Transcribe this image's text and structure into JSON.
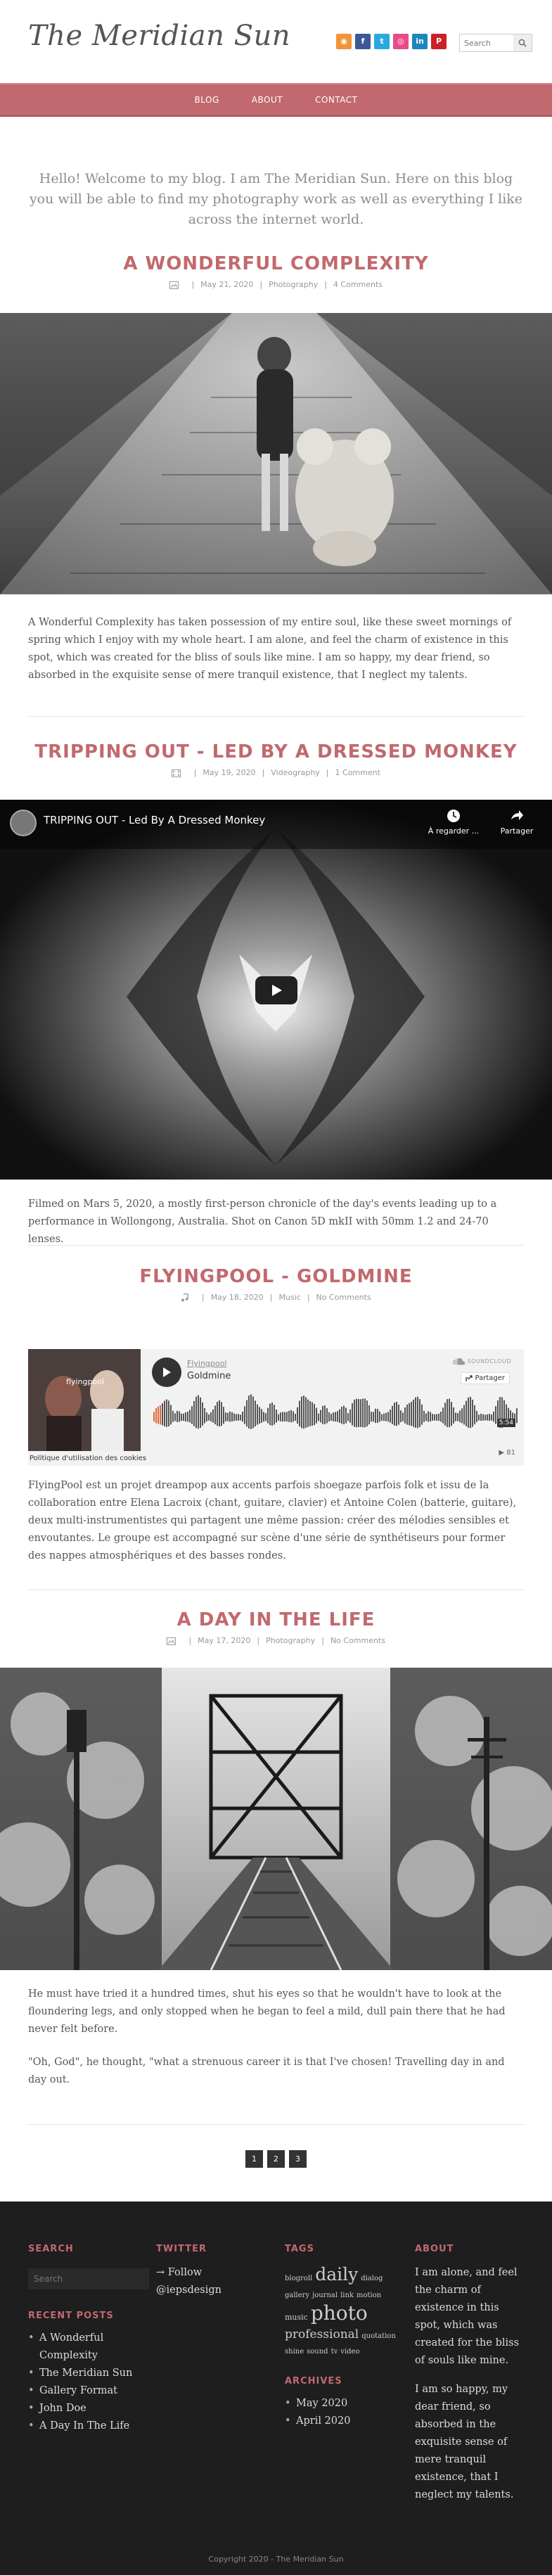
{
  "site": {
    "title": "The Meridian Sun"
  },
  "social_icons": [
    {
      "name": "rss-icon",
      "color": "#f2933a",
      "glyph": "⦿"
    },
    {
      "name": "facebook-icon",
      "color": "#3b5998",
      "glyph": "f"
    },
    {
      "name": "twitter-icon",
      "color": "#2aa9e0",
      "glyph": "t"
    },
    {
      "name": "dribbble-icon",
      "color": "#ea4c89",
      "glyph": "◎"
    },
    {
      "name": "linkedin-icon",
      "color": "#1c87bd",
      "glyph": "in"
    },
    {
      "name": "pinterest-icon",
      "color": "#cb2027",
      "glyph": "P"
    }
  ],
  "search": {
    "placeholder": "Search"
  },
  "nav": {
    "items": [
      "BLOG",
      "ABOUT",
      "CONTACT"
    ]
  },
  "intro": "Hello! Welcome to my blog. I am The Meridian Sun. Here on this blog you will be able to find my photography work as well as everything I like across the internet world.",
  "posts": [
    {
      "title": "A WONDERFUL COMPLEXITY",
      "date": "May 21, 2020",
      "category": "Photography",
      "comments": "4 Comments",
      "excerpt": "A Wonderful Complexity has taken possession of my entire soul, like these sweet mornings of spring which I enjoy with my whole heart. I am alone, and feel the charm of existence in this spot, which was created for the bliss of souls like mine. I am so happy, my dear friend, so absorbed in the exquisite sense of mere tranquil existence, that I neglect my talents."
    },
    {
      "title": "TRIPPING OUT - LED BY A DRESSED MONKEY",
      "date": "May 19, 2020",
      "category": "Videography",
      "comments": "1 Comment",
      "video": {
        "title": "TRIPPING OUT - Led By A Dressed Monkey",
        "watch_later": "À regarder ...",
        "share": "Partager"
      },
      "excerpt": "Filmed on Mars 5, 2020, a mostly first-person chronicle of the day's events leading up to a performance in Wollongong, Australia. Shot on Canon 5D mkII with 50mm 1.2 and 24-70 lenses."
    },
    {
      "title": "FLYINGPOOL - GOLDMINE",
      "date": "May 18, 2020",
      "category": "Music",
      "comments": "No Comments",
      "player": {
        "artist": "Flyingpool",
        "track": "Goldmine",
        "brand": "SOUNDCLOUD",
        "share": "Partager",
        "duration": "5:54",
        "plays": "81",
        "cookie_policy": "Politique d'utilisation des cookies",
        "cover_text": "flyingpool"
      },
      "excerpt_lead": "FlyingPool",
      "excerpt": " est un projet dreampop aux accents parfois shoegaze parfois folk et issu de la collaboration entre Elena Lacroix (chant, guitare, clavier) et Antoine Colen (batterie, guitare), deux multi-instrumentistes qui partagent une même passion: créer des mélodies sensibles et envoutantes. Le groupe est accompagné sur scène d'une série de synthétiseurs pour former des nappes atmosphériques et des basses rondes."
    },
    {
      "title": "A DAY IN THE LIFE",
      "date": "May 17, 2020",
      "category": "Photography",
      "comments": "No Comments",
      "excerpt": "He must have tried it a hundred times, shut his eyes so that he wouldn't have to look at the floundering legs, and only stopped when he began to feel a mild, dull pain there that he had never felt before.",
      "excerpt2": "\"Oh, God\", he thought, \"what a strenuous career it is that I've chosen! Travelling day in and day out."
    }
  ],
  "pagination": [
    "1",
    "2",
    "3"
  ],
  "footer": {
    "search_heading": "SEARCH",
    "search_placeholder": "Search",
    "recent_heading": "RECENT POSTS",
    "recent_posts": [
      "A Wonderful Complexity",
      "The Meridian Sun",
      "Gallery Format",
      "John Doe",
      "A Day In The Life"
    ],
    "twitter_heading": "TWITTER",
    "twitter_follow": "→ Follow @iepsdesign",
    "tags_heading": "TAGS",
    "tags": [
      {
        "t": "blogroll",
        "s": 10
      },
      {
        "t": "daily",
        "s": 25
      },
      {
        "t": "dialog",
        "s": 10
      },
      {
        "t": "gallery",
        "s": 10
      },
      {
        "t": "journal",
        "s": 10
      },
      {
        "t": "link",
        "s": 10
      },
      {
        "t": "motion",
        "s": 10
      },
      {
        "t": "music",
        "s": 11
      },
      {
        "t": "photo",
        "s": 28
      },
      {
        "t": "professional",
        "s": 17
      },
      {
        "t": "quotation",
        "s": 10
      },
      {
        "t": "shine",
        "s": 10
      },
      {
        "t": "sound",
        "s": 10
      },
      {
        "t": "tv",
        "s": 10
      },
      {
        "t": "video",
        "s": 10
      }
    ],
    "archives_heading": "ARCHIVES",
    "archives": [
      "May 2020",
      "April 2020"
    ],
    "about_heading": "ABOUT",
    "about_p1": "I am alone, and feel the charm of existence in this spot, which was created for the bliss of souls like mine.",
    "about_p2": "I am so happy, my dear friend, so absorbed in the exquisite sense of mere tranquil existence, that I neglect my talents.",
    "copyright": "Copyright 2020 - The Meridian Sun"
  }
}
